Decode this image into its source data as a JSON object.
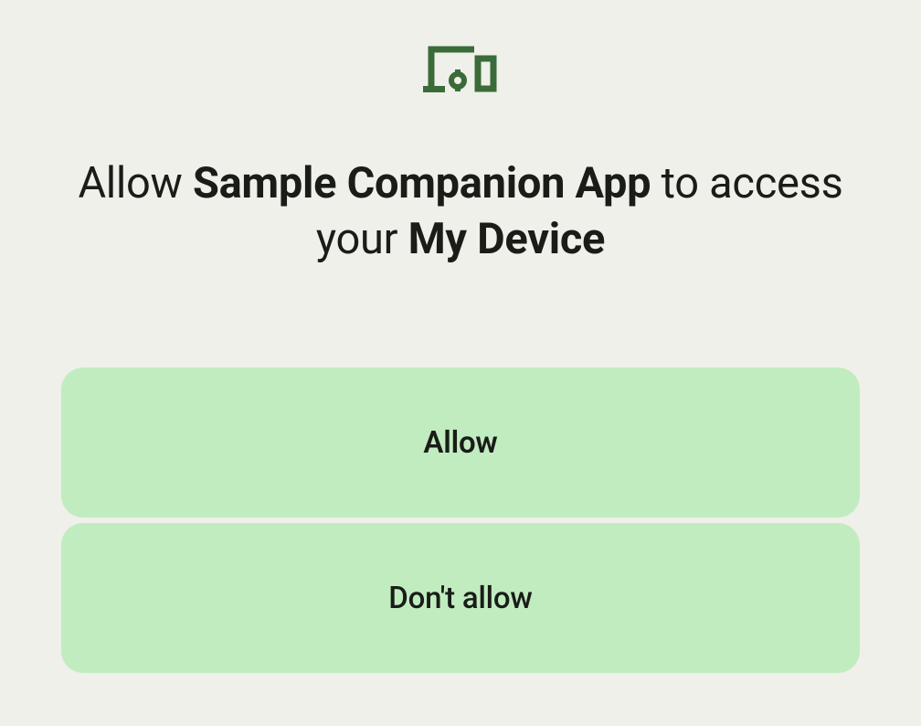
{
  "icon": {
    "name": "devices-icon",
    "color": "#3a6b39"
  },
  "title": {
    "prefix": "Allow ",
    "appName": "Sample Companion App",
    "middle": " to access your ",
    "deviceName": "My Device"
  },
  "buttons": {
    "allow": "Allow",
    "deny": "Don't allow"
  }
}
